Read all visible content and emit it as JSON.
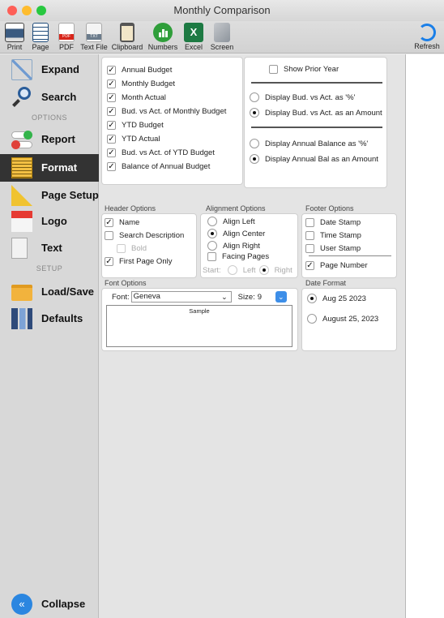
{
  "window": {
    "title": "Monthly Comparison"
  },
  "toolbar": {
    "print": "Print",
    "page": "Page",
    "pdf": "PDF",
    "textfile": "Text File",
    "clipboard": "Clipboard",
    "numbers": "Numbers",
    "excel": "Excel",
    "screen": "Screen",
    "refresh": "Refresh",
    "pdf_icon_text": "PDF",
    "txt_icon_text": "TXT"
  },
  "sidebar": {
    "expand": "Expand",
    "search": "Search",
    "options_section": "OPTIONS",
    "report": "Report",
    "format": "Format",
    "page_setup": "Page Setup",
    "logo": "Logo",
    "text": "Text",
    "setup_section": "SETUP",
    "load_save": "Load/Save",
    "defaults": "Defaults",
    "collapse": "Collapse"
  },
  "columns": {
    "items": [
      {
        "label": "Annual Budget",
        "checked": true
      },
      {
        "label": "Monthly Budget",
        "checked": true
      },
      {
        "label": "Month Actual",
        "checked": true
      },
      {
        "label": "Bud. vs Act. of Monthly Budget",
        "checked": true
      },
      {
        "label": "YTD Budget",
        "checked": true
      },
      {
        "label": "YTD Actual",
        "checked": true
      },
      {
        "label": "Bud. vs Act. of YTD Budget",
        "checked": true
      },
      {
        "label": "Balance of Annual Budget",
        "checked": true
      }
    ],
    "show_prior_year": "Show Prior Year",
    "display_pct": "Display Bud. vs Act. as '%'",
    "display_amount": "Display Bud. vs Act. as an Amount",
    "annual_pct": "Display Annual Balance as '%'",
    "annual_amount": "Display Annual Bal as an Amount"
  },
  "header_options": {
    "title": "Header Options",
    "name": "Name",
    "search_desc": "Search Description",
    "bold": "Bold",
    "first_page": "First Page Only"
  },
  "alignment_options": {
    "title": "Alignment Options",
    "left": "Align Left",
    "center": "Align Center",
    "right": "Align Right",
    "facing": "Facing Pages",
    "start": "Start:",
    "start_left": "Left",
    "start_right": "Right",
    "selected": "Align Center"
  },
  "footer_options": {
    "title": "Footer Options",
    "date": "Date Stamp",
    "time": "Time Stamp",
    "user": "User Stamp",
    "page_number": "Page Number"
  },
  "font_options": {
    "title": "Font Options",
    "font_label": "Font:",
    "font_value": "Geneva",
    "size_label": "Size:",
    "size_value": "9",
    "sample": "Sample"
  },
  "date_format": {
    "title": "Date Format",
    "short": "Aug 25 2023",
    "long": "August 25, 2023",
    "selected": "Aug 25 2023"
  },
  "colors": {
    "accent": "#1a7fe8",
    "sidebar_selected": "#333333",
    "numbers_green": "#2f9e3a"
  }
}
